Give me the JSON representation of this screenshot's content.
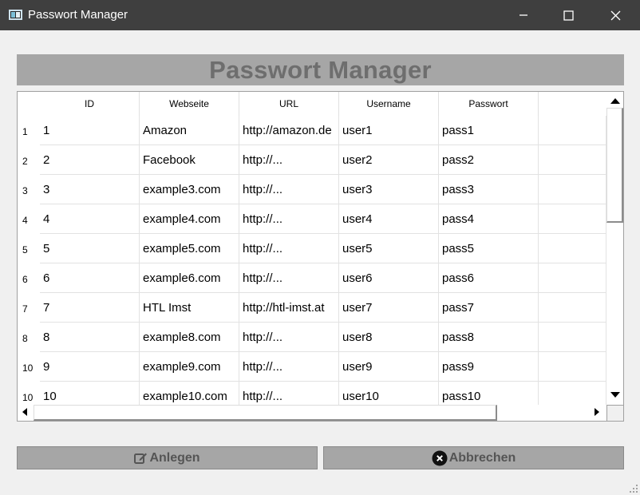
{
  "window": {
    "title": "Passwort Manager",
    "icon": "app-window-icon",
    "controls": [
      "minimize-icon",
      "maximize-icon",
      "close-icon"
    ]
  },
  "header": {
    "title": "Passwort Manager"
  },
  "table": {
    "columns": [
      "ID",
      "Webseite",
      "URL",
      "Username",
      "Passwort"
    ],
    "row_headers": [
      "1",
      "2",
      "3",
      "4",
      "5",
      "6",
      "7",
      "8",
      "10",
      "10"
    ],
    "rows": [
      [
        "1",
        "Amazon",
        "http://amazon.de",
        "user1",
        "pass1"
      ],
      [
        "2",
        "Facebook",
        "http://...",
        "user2",
        "pass2"
      ],
      [
        "3",
        "example3.com",
        "http://...",
        "user3",
        "pass3"
      ],
      [
        "4",
        "example4.com",
        "http://...",
        "user4",
        "pass4"
      ],
      [
        "5",
        "example5.com",
        "http://...",
        "user5",
        "pass5"
      ],
      [
        "6",
        "example6.com",
        "http://...",
        "user6",
        "pass6"
      ],
      [
        "7",
        "HTL Imst",
        "http://htl-imst.at",
        "user7",
        "pass7"
      ],
      [
        "8",
        "example8.com",
        "http://...",
        "user8",
        "pass8"
      ],
      [
        "9",
        "example9.com",
        "http://...",
        "user9",
        "pass9"
      ],
      [
        "10",
        "example10.com",
        "http://...",
        "user10",
        "pass10"
      ]
    ]
  },
  "buttons": {
    "create": {
      "label": "Anlegen",
      "icon": "edit-icon"
    },
    "cancel": {
      "label": "Abbrechen",
      "icon": "cancel-circle-icon"
    }
  },
  "colors": {
    "titlebar": "#3f3f3f",
    "background": "#f0f0f0",
    "header_bg": "#a6a6a6",
    "header_text": "#6e6e6e",
    "button_bg": "#a6a6a6",
    "button_text": "#555555"
  }
}
